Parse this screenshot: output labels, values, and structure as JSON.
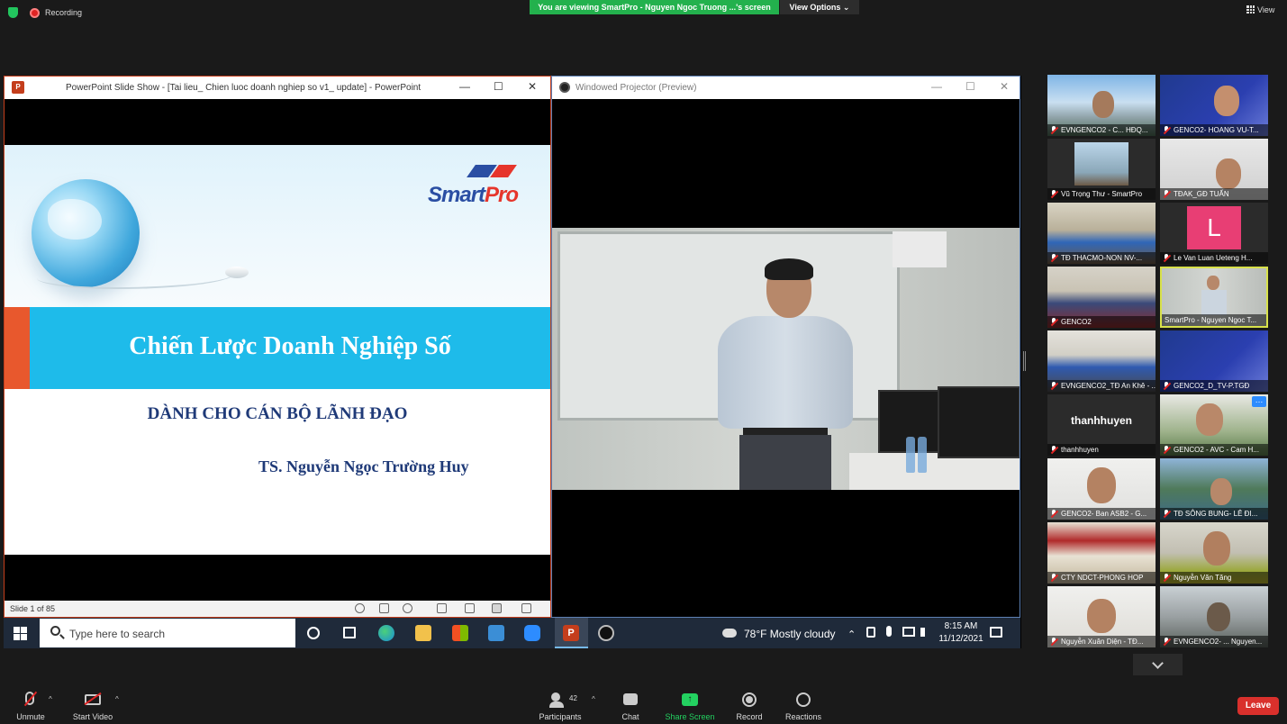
{
  "top_bar": {
    "recording": "Recording",
    "viewing_banner": "You are viewing SmartPro - Nguyen Ngoc Truong ...'s screen",
    "view_options": "View Options",
    "view_options_caret": "⌄",
    "view": "View"
  },
  "ppt_window": {
    "icon_label": "P",
    "title": "PowerPoint Slide Show - [Tai lieu_ Chien luoc doanh nghiep so v1_ update] - PowerPoint",
    "controls": {
      "minimize": "—",
      "maximize": "☐",
      "close": "✕"
    },
    "slide": {
      "logo_smart": "Smart",
      "logo_pro": "Pro",
      "title": "Chiến Lược Doanh Nghiệp Số",
      "subtitle": "DÀNH CHO CÁN BỘ LÃNH ĐẠO",
      "author": "TS. Nguyễn Ngọc Trường Huy"
    },
    "status_bar": {
      "slide_counter": "Slide 1 of 85"
    }
  },
  "projector_window": {
    "title": "Windowed Projector (Preview)",
    "controls": {
      "minimize": "—",
      "maximize": "☐",
      "close": "✕"
    }
  },
  "taskbar": {
    "search_placeholder": "Type here to search",
    "ppt_label": "P",
    "weather": "78°F  Mostly cloudy",
    "tray_up": "⌃",
    "time": "8:15 AM",
    "date": "11/12/2021"
  },
  "gallery": {
    "participants": [
      {
        "name": "EVNGENCO2 - C... HĐQ..."
      },
      {
        "name": "GENCO2- HOANG VU-T..."
      },
      {
        "name": "Vũ Trọng Thư - SmartPro"
      },
      {
        "name": "TĐAK_GĐ TUẤN"
      },
      {
        "name": "TĐ THACMO-NON NV-..."
      },
      {
        "name": "Le Van Luan Ueteng H...",
        "avatar_letter": "L"
      },
      {
        "name": "GENCO2"
      },
      {
        "name": "SmartPro - Nguyen Ngoc T..."
      },
      {
        "name": "EVNGENCO2_TĐ An Khê - ..."
      },
      {
        "name": "GENCO2_D_TV-P.TGĐ"
      },
      {
        "name": "thanhhuyen",
        "display": "thanhhuyen"
      },
      {
        "name": "GENCO2 - AVC - Cam H..."
      },
      {
        "name": "GENCO2- Ban ASB2 - G..."
      },
      {
        "name": "TĐ SÔNG BUNG- LÊ ĐI..."
      },
      {
        "name": "CTY NDCT-PHONG HOP"
      },
      {
        "name": "Nguyễn Văn Tăng"
      },
      {
        "name": "Nguyễn Xuân Diện - TĐ..."
      },
      {
        "name": "EVNGENCO2- ... Nguyen..."
      }
    ]
  },
  "zoom_bar": {
    "unmute": "Unmute",
    "start_video": "Start Video",
    "participants": "Participants",
    "participant_count": "42",
    "chat": "Chat",
    "share_screen": "Share Screen",
    "record": "Record",
    "reactions": "Reactions",
    "leave": "Leave",
    "caret": "^"
  },
  "colors": {
    "banner_green": "#23b14d",
    "ppt_accent": "#c43e1c",
    "slide_band": "#1ebbea",
    "slide_accent": "#e8582d",
    "slide_text": "#1f3a78",
    "leave_red": "#d9302c",
    "active_tile": "#d8e14a"
  }
}
